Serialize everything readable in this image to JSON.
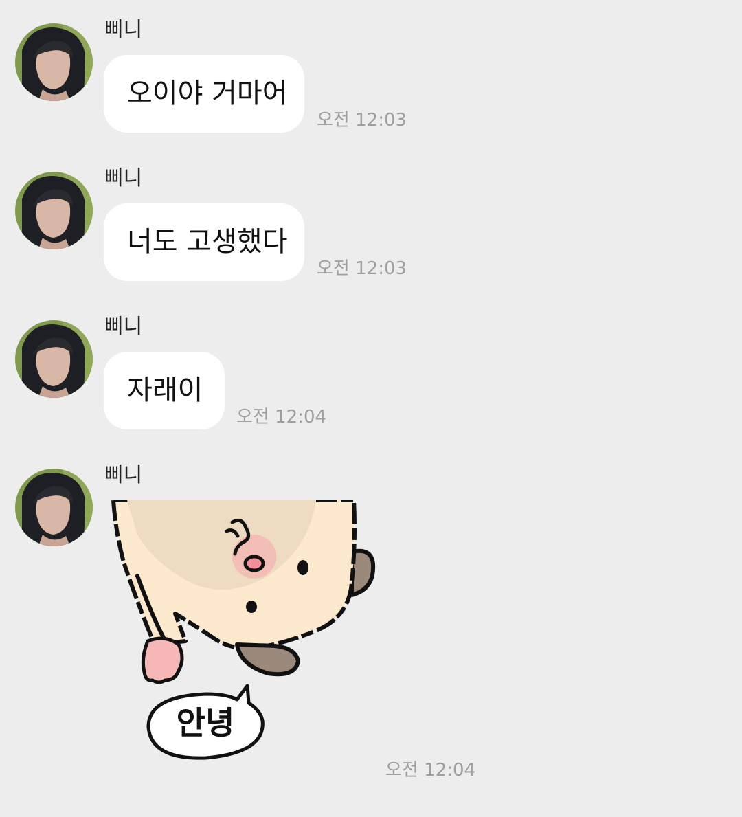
{
  "chat": {
    "messages": [
      {
        "sender": "삐니",
        "text": "오이야 거마어",
        "time": "오전 12:03"
      },
      {
        "sender": "삐니",
        "text": "너도 고생했다",
        "time": "오전 12:03"
      },
      {
        "sender": "삐니",
        "text": "자래이",
        "time": "오전 12:04"
      },
      {
        "sender": "삐니",
        "sticker": {
          "icon": "bear-sticker-icon",
          "text": "안녕"
        },
        "time": "오전 12:04"
      }
    ]
  },
  "colors": {
    "background": "#ededed",
    "bubble": "#ffffff",
    "time_text": "#9e9e9e"
  }
}
